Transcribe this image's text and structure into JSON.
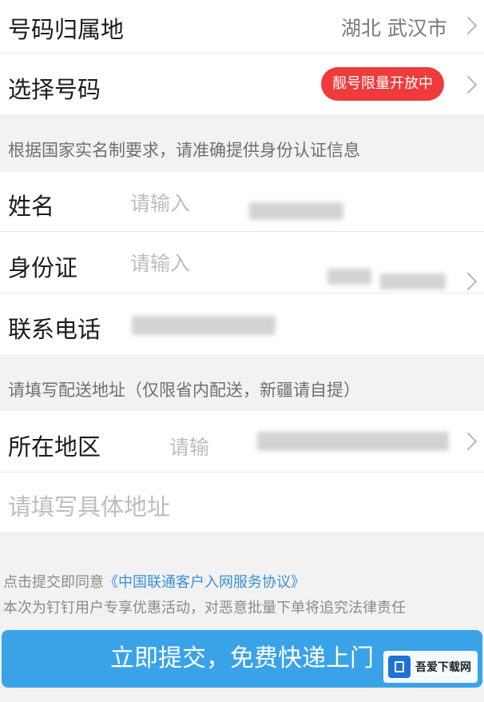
{
  "number_location": {
    "label": "号码归属地",
    "value": "湖北  武汉市"
  },
  "choose_number": {
    "label": "选择号码",
    "badge": "靓号限量开放中"
  },
  "id_notice": "根据国家实名制要求，请准确提供身份认证信息",
  "name_field": {
    "label": "姓名",
    "placeholder": "请输入"
  },
  "id_field": {
    "label": "身份证",
    "placeholder": "请输入"
  },
  "phone_field": {
    "label": "联系电话"
  },
  "address_notice": "请填写配送地址（仅限省内配送，新疆请自提）",
  "region_field": {
    "label": "所在地区",
    "placeholder": "请输"
  },
  "address_detail": {
    "placeholder": "请填写具体地址"
  },
  "agreement": {
    "prefix": "点击提交即同意",
    "link": "《中国联通客户入网服务协议》",
    "notice": "本次为钉钉用户专享优惠活动，对恶意批量下单将追究法律责任"
  },
  "submit_label": "立即提交，免费快递上门",
  "watermark": {
    "text": "吾爱下载网"
  },
  "colors": {
    "accent": "#3aa3e8",
    "badge": "#ef3b3b",
    "link": "#3b8fd6"
  }
}
